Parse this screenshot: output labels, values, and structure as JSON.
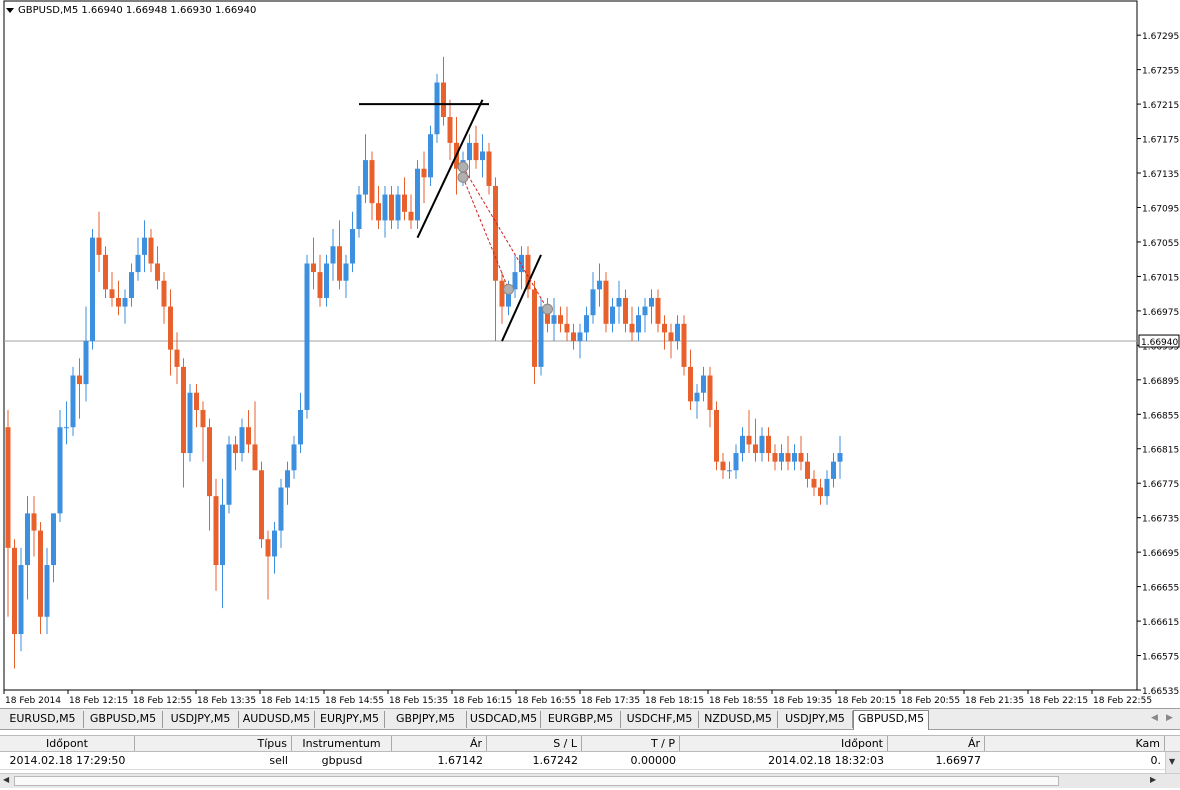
{
  "window": {
    "symbol_info": "GBPUSD,M5  1.66940  1.66948  1.66930  1.66940",
    "current_price_label": "1.66940"
  },
  "chart_data": {
    "type": "candlestick",
    "symbol": "GBPUSD",
    "timeframe": "M5",
    "current_price": 1.6694,
    "ylim": [
      1.66535,
      1.6733
    ],
    "y_ticks": [
      "1.67295",
      "1.67255",
      "1.67215",
      "1.67175",
      "1.67135",
      "1.67095",
      "1.67055",
      "1.67015",
      "1.66975",
      "1.66935",
      "1.66895",
      "1.66855",
      "1.66815",
      "1.66775",
      "1.66735",
      "1.66695",
      "1.66655",
      "1.66615",
      "1.66575",
      "1.66535"
    ],
    "x_ticks": [
      "18 Feb 2014",
      "18 Feb 12:15",
      "18 Feb 12:55",
      "18 Feb 13:35",
      "18 Feb 14:15",
      "18 Feb 14:55",
      "18 Feb 15:35",
      "18 Feb 16:15",
      "18 Feb 16:55",
      "18 Feb 17:35",
      "18 Feb 18:15",
      "18 Feb 18:55",
      "18 Feb 19:35",
      "18 Feb 20:15",
      "18 Feb 20:55",
      "18 Feb 21:35",
      "18 Feb 22:15",
      "18 Feb 22:55"
    ],
    "colors": {
      "bull": "#3d8fe0",
      "bear": "#e8602c",
      "line": "#000000",
      "trade": "#d02020"
    },
    "candles": [
      [
        1.6684,
        1.6686,
        1.6662,
        1.667
      ],
      [
        1.667,
        1.6671,
        1.6656,
        1.666
      ],
      [
        1.666,
        1.667,
        1.6658,
        1.6668
      ],
      [
        1.6668,
        1.6676,
        1.6664,
        1.6674
      ],
      [
        1.6674,
        1.6676,
        1.6669,
        1.6672
      ],
      [
        1.6672,
        1.6673,
        1.666,
        1.6662
      ],
      [
        1.6662,
        1.667,
        1.666,
        1.6668
      ],
      [
        1.6668,
        1.6674,
        1.6666,
        1.6674
      ],
      [
        1.6674,
        1.6686,
        1.6673,
        1.6684
      ],
      [
        1.6684,
        1.6687,
        1.6682,
        1.6684
      ],
      [
        1.6684,
        1.6691,
        1.6683,
        1.669
      ],
      [
        1.669,
        1.6692,
        1.6685,
        1.6689
      ],
      [
        1.6689,
        1.6698,
        1.6687,
        1.6694
      ],
      [
        1.6694,
        1.6707,
        1.6693,
        1.6706
      ],
      [
        1.6706,
        1.6709,
        1.6702,
        1.6704
      ],
      [
        1.6704,
        1.6705,
        1.6699,
        1.67
      ],
      [
        1.67,
        1.6702,
        1.6698,
        1.6699
      ],
      [
        1.6699,
        1.6701,
        1.6697,
        1.6698
      ],
      [
        1.6698,
        1.67,
        1.6696,
        1.6699
      ],
      [
        1.6699,
        1.6703,
        1.6698,
        1.6702
      ],
      [
        1.6702,
        1.6706,
        1.6701,
        1.6704
      ],
      [
        1.6704,
        1.6708,
        1.6702,
        1.6706
      ],
      [
        1.6706,
        1.6707,
        1.6702,
        1.6703
      ],
      [
        1.6703,
        1.6705,
        1.67,
        1.6701
      ],
      [
        1.6701,
        1.6702,
        1.6696,
        1.6698
      ],
      [
        1.6698,
        1.67,
        1.669,
        1.6693
      ],
      [
        1.6693,
        1.6695,
        1.6689,
        1.6691
      ],
      [
        1.6691,
        1.6692,
        1.6677,
        1.6681
      ],
      [
        1.6681,
        1.6689,
        1.668,
        1.6688
      ],
      [
        1.6688,
        1.6689,
        1.6684,
        1.6686
      ],
      [
        1.6686,
        1.6687,
        1.668,
        1.6684
      ],
      [
        1.6684,
        1.6685,
        1.6672,
        1.6676
      ],
      [
        1.6676,
        1.6678,
        1.6665,
        1.6668
      ],
      [
        1.6668,
        1.6678,
        1.6663,
        1.6675
      ],
      [
        1.6675,
        1.6683,
        1.6674,
        1.6682
      ],
      [
        1.6682,
        1.6683,
        1.6679,
        1.6681
      ],
      [
        1.6681,
        1.6685,
        1.668,
        1.6684
      ],
      [
        1.6684,
        1.6686,
        1.6681,
        1.6682
      ],
      [
        1.6682,
        1.6687,
        1.6679,
        1.6679
      ],
      [
        1.6679,
        1.668,
        1.667,
        1.6671
      ],
      [
        1.6671,
        1.6672,
        1.6664,
        1.6669
      ],
      [
        1.6669,
        1.6673,
        1.6667,
        1.6672
      ],
      [
        1.6672,
        1.6678,
        1.667,
        1.6677
      ],
      [
        1.6677,
        1.668,
        1.6675,
        1.6679
      ],
      [
        1.6679,
        1.6683,
        1.6678,
        1.6682
      ],
      [
        1.6682,
        1.6688,
        1.6681,
        1.6686
      ],
      [
        1.6686,
        1.6704,
        1.6685,
        1.6703
      ],
      [
        1.6703,
        1.6706,
        1.67,
        1.6702
      ],
      [
        1.6702,
        1.6704,
        1.6698,
        1.6699
      ],
      [
        1.6699,
        1.6704,
        1.6698,
        1.6703
      ],
      [
        1.6703,
        1.6707,
        1.6701,
        1.6705
      ],
      [
        1.6705,
        1.6708,
        1.67,
        1.6701
      ],
      [
        1.6701,
        1.6704,
        1.6699,
        1.6703
      ],
      [
        1.6703,
        1.6709,
        1.6702,
        1.6707
      ],
      [
        1.6707,
        1.6712,
        1.6706,
        1.6711
      ],
      [
        1.6711,
        1.6718,
        1.671,
        1.6715
      ],
      [
        1.6715,
        1.6716,
        1.6708,
        1.671
      ],
      [
        1.671,
        1.6712,
        1.6707,
        1.6708
      ],
      [
        1.6708,
        1.6712,
        1.6706,
        1.6711
      ],
      [
        1.6711,
        1.6712,
        1.6707,
        1.6708
      ],
      [
        1.6708,
        1.6712,
        1.6707,
        1.6711
      ],
      [
        1.6711,
        1.6713,
        1.6708,
        1.6709
      ],
      [
        1.6709,
        1.6711,
        1.6707,
        1.6708
      ],
      [
        1.6708,
        1.6715,
        1.6707,
        1.6714
      ],
      [
        1.6714,
        1.6716,
        1.671,
        1.6713
      ],
      [
        1.6713,
        1.6719,
        1.6712,
        1.6718
      ],
      [
        1.6718,
        1.6725,
        1.6717,
        1.6724
      ],
      [
        1.6724,
        1.6727,
        1.6719,
        1.672
      ],
      [
        1.672,
        1.6722,
        1.6715,
        1.6717
      ],
      [
        1.6717,
        1.672,
        1.6711,
        1.6714
      ],
      [
        1.6714,
        1.6716,
        1.6712,
        1.6715
      ],
      [
        1.6715,
        1.6718,
        1.6713,
        1.6717
      ],
      [
        1.6717,
        1.6719,
        1.6714,
        1.6715
      ],
      [
        1.6715,
        1.6718,
        1.6713,
        1.6716
      ],
      [
        1.6716,
        1.6717,
        1.6711,
        1.6712
      ],
      [
        1.6712,
        1.6713,
        1.6694,
        1.6701
      ],
      [
        1.6701,
        1.6702,
        1.6696,
        1.6698
      ],
      [
        1.6698,
        1.6701,
        1.6697,
        1.67
      ],
      [
        1.67,
        1.6704,
        1.6699,
        1.6702
      ],
      [
        1.6702,
        1.6705,
        1.67,
        1.6704
      ],
      [
        1.6704,
        1.6705,
        1.6699,
        1.67
      ],
      [
        1.67,
        1.6701,
        1.6689,
        1.6691
      ],
      [
        1.6691,
        1.6699,
        1.669,
        1.6698
      ],
      [
        1.6698,
        1.6699,
        1.6695,
        1.6696
      ],
      [
        1.6696,
        1.6699,
        1.6694,
        1.6697
      ],
      [
        1.6697,
        1.6698,
        1.6695,
        1.6696
      ],
      [
        1.6696,
        1.6698,
        1.6694,
        1.6695
      ],
      [
        1.6695,
        1.6696,
        1.6693,
        1.6694
      ],
      [
        1.6694,
        1.6696,
        1.6692,
        1.6695
      ],
      [
        1.6695,
        1.6698,
        1.6694,
        1.6697
      ],
      [
        1.6697,
        1.6702,
        1.6696,
        1.67
      ],
      [
        1.67,
        1.6703,
        1.6698,
        1.6701
      ],
      [
        1.6701,
        1.6702,
        1.6695,
        1.6696
      ],
      [
        1.6696,
        1.6699,
        1.6695,
        1.6698
      ],
      [
        1.6698,
        1.6701,
        1.6696,
        1.6699
      ],
      [
        1.6699,
        1.67,
        1.6695,
        1.6696
      ],
      [
        1.6696,
        1.6698,
        1.6694,
        1.6695
      ],
      [
        1.6695,
        1.6698,
        1.6694,
        1.6697
      ],
      [
        1.6697,
        1.6699,
        1.6695,
        1.6698
      ],
      [
        1.6698,
        1.67,
        1.6696,
        1.6699
      ],
      [
        1.6699,
        1.67,
        1.6695,
        1.6696
      ],
      [
        1.6696,
        1.6697,
        1.6693,
        1.6695
      ],
      [
        1.6695,
        1.6696,
        1.6692,
        1.6694
      ],
      [
        1.6694,
        1.6697,
        1.6693,
        1.6696
      ],
      [
        1.6696,
        1.6697,
        1.669,
        1.6691
      ],
      [
        1.6691,
        1.6693,
        1.6686,
        1.6687
      ],
      [
        1.6687,
        1.6689,
        1.6685,
        1.6688
      ],
      [
        1.6688,
        1.6691,
        1.6687,
        1.669
      ],
      [
        1.669,
        1.6691,
        1.6684,
        1.6686
      ],
      [
        1.6686,
        1.6687,
        1.6679,
        1.668
      ],
      [
        1.668,
        1.6681,
        1.6678,
        1.6679
      ],
      [
        1.6679,
        1.668,
        1.6678,
        1.6679
      ],
      [
        1.6679,
        1.6682,
        1.6678,
        1.6681
      ],
      [
        1.6681,
        1.6684,
        1.668,
        1.6683
      ],
      [
        1.6683,
        1.6686,
        1.6681,
        1.6682
      ],
      [
        1.6682,
        1.6685,
        1.668,
        1.6681
      ],
      [
        1.6681,
        1.6684,
        1.668,
        1.6683
      ],
      [
        1.6683,
        1.6684,
        1.668,
        1.6681
      ],
      [
        1.6681,
        1.6682,
        1.6679,
        1.668
      ],
      [
        1.668,
        1.6682,
        1.6679,
        1.6681
      ],
      [
        1.6681,
        1.6683,
        1.6679,
        1.668
      ],
      [
        1.668,
        1.6682,
        1.6679,
        1.6681
      ],
      [
        1.6681,
        1.6683,
        1.6679,
        1.668
      ],
      [
        1.668,
        1.6681,
        1.6677,
        1.6678
      ],
      [
        1.6678,
        1.6679,
        1.6676,
        1.6677
      ],
      [
        1.6677,
        1.6678,
        1.6675,
        1.6676
      ],
      [
        1.6676,
        1.6679,
        1.6675,
        1.6678
      ],
      [
        1.6678,
        1.6681,
        1.6677,
        1.668
      ],
      [
        1.668,
        1.6683,
        1.6678,
        1.6681
      ]
    ],
    "trendlines": [
      {
        "name": "resistance-line",
        "p1": [
          54,
          1.67215
        ],
        "p2": [
          74,
          1.67215
        ]
      },
      {
        "name": "channel-line-upper",
        "p1": [
          63,
          1.6706
        ],
        "p2": [
          73,
          1.6722
        ]
      },
      {
        "name": "channel-line-lower",
        "p1": [
          76,
          1.6694
        ],
        "p2": [
          82,
          1.6704
        ]
      }
    ],
    "trades": [
      {
        "name": "trade-1",
        "entry": [
          70,
          1.67142
        ],
        "exit": [
          83,
          1.66977
        ]
      },
      {
        "name": "trade-2",
        "entry": [
          70,
          1.6713
        ],
        "exit": [
          77,
          1.67
        ]
      }
    ]
  },
  "tabs": [
    "EURUSD,M5",
    "GBPUSD,M5",
    "USDJPY,M5",
    "AUDUSD,M5",
    "EURJPY,M5",
    "GBPJPY,M5",
    "USDCAD,M5",
    "EURGBP,M5",
    "USDCHF,M5",
    "NZDUSD,M5",
    "USDJPY,M5",
    "GBPUSD,M5"
  ],
  "active_tab_index": 11,
  "terminal": {
    "headers": [
      "Időpont",
      "Típus",
      "Instrumentum",
      "Ár",
      "S / L",
      "T / P",
      "Időpont",
      "Ár",
      "Kam"
    ],
    "rows": [
      [
        "2014.02.18 17:29:50",
        "sell",
        "gbpusd",
        "1.67142",
        "1.67242",
        "0.00000",
        "2014.02.18 18:32:03",
        "1.66977",
        "0."
      ]
    ]
  }
}
